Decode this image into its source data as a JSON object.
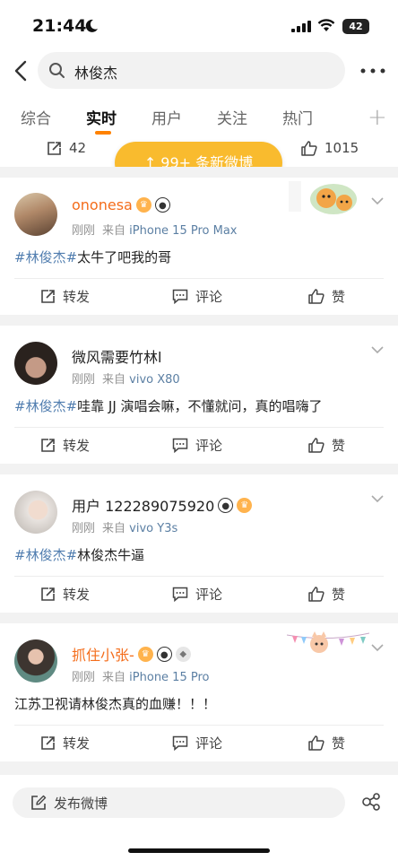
{
  "status_bar": {
    "time": "21:44",
    "battery": "42"
  },
  "search": {
    "query": "林俊杰"
  },
  "tabs": [
    {
      "label": "综合"
    },
    {
      "label": "实时"
    },
    {
      "label": "用户"
    },
    {
      "label": "关注"
    },
    {
      "label": "热门"
    }
  ],
  "previous_post": {
    "repost_count": "42",
    "like_count": "1015"
  },
  "new_posts_banner": "↑ 99+ 条新微博",
  "posts": [
    {
      "username": "ononesa",
      "time": "刚刚",
      "source_prefix": "来自",
      "device": "iPhone 15 Pro Max",
      "hashtag": "#林俊杰#",
      "text": "太牛了吧我的哥"
    },
    {
      "username": "微风需要竹林l",
      "time": "刚刚",
      "source_prefix": "来自",
      "device": "vivo X80",
      "hashtag": "#林俊杰#",
      "text": "哇靠 JJ 演唱会嘛，不懂就问，真的唱嗨了"
    },
    {
      "username": "用户 122289075920",
      "time": "刚刚",
      "source_prefix": "来自",
      "device": "vivo Y3s",
      "hashtag": "#林俊杰#",
      "text": "林俊杰牛逼"
    },
    {
      "username": "抓住小张-",
      "time": "刚刚",
      "source_prefix": "来自",
      "device": "iPhone 15 Pro",
      "hashtag": "",
      "text": "江苏卫视请林俊杰真的血赚！！！"
    }
  ],
  "actions": {
    "repost": "转发",
    "comment": "评论",
    "like": "赞"
  },
  "compose": {
    "placeholder": "发布微博"
  },
  "colors": {
    "accent": "#ff8200",
    "banner": "#f9bb2e",
    "link": "#507daf",
    "vip_name": "#f46d1b"
  }
}
